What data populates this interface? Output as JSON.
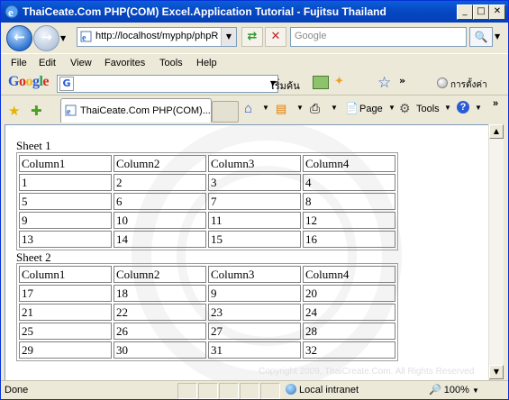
{
  "window": {
    "title": "ThaiCeate.Com PHP(COM) Excel.Application Tutorial - Fujitsu Thailand",
    "minimize": "_",
    "maximize": "□",
    "close": "✕"
  },
  "address": {
    "url": "http://localhost/myphp/phpR",
    "back_icon": "back-arrow-icon",
    "forward_icon": "forward-arrow-icon"
  },
  "search": {
    "placeholder": "Google"
  },
  "menu": [
    "File",
    "Edit",
    "View",
    "Favorites",
    "Tools",
    "Help"
  ],
  "google_toolbar": {
    "logo": "Google",
    "g_icon": "G",
    "search_button": "เริ่มค้น",
    "more": "»",
    "settings": "การตั้งค่า"
  },
  "tabbar": {
    "tab_title": "ThaiCeate.Com PHP(COM)...",
    "page": "Page",
    "tools": "Tools",
    "more": "»"
  },
  "sheets": [
    {
      "label": "Sheet 1",
      "headers": [
        "Column1",
        "Column2",
        "Column3",
        "Column4"
      ],
      "rows": [
        [
          "1",
          "2",
          "3",
          "4"
        ],
        [
          "5",
          "6",
          "7",
          "8"
        ],
        [
          "9",
          "10",
          "11",
          "12"
        ],
        [
          "13",
          "14",
          "15",
          "16"
        ]
      ]
    },
    {
      "label": "Sheet 2",
      "headers": [
        "Column1",
        "Column2",
        "Column3",
        "Column4"
      ],
      "rows": [
        [
          "17",
          "18",
          "9",
          "20"
        ],
        [
          "21",
          "22",
          "23",
          "24"
        ],
        [
          "25",
          "26",
          "27",
          "28"
        ],
        [
          "29",
          "30",
          "31",
          "32"
        ]
      ]
    }
  ],
  "footer": {
    "copyright": "Copyright 2009, ThaiCreate.Com. All Rights Reserved"
  },
  "status": {
    "text": "Done",
    "zone": "Local intranet",
    "zoom": "100%"
  },
  "colors": {
    "titlebar": "#0848c4",
    "content_bg": "#ffffff",
    "chrome_bg": "#ece9d8"
  }
}
